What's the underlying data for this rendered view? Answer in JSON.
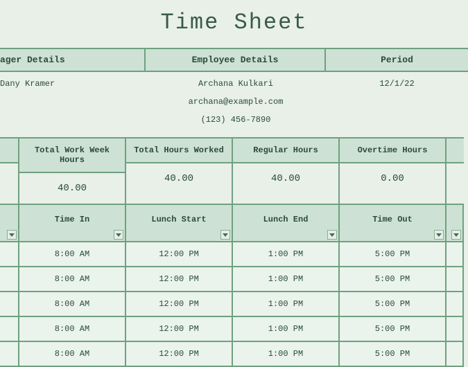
{
  "title": "Time Sheet",
  "headers": {
    "manager": "ager Details",
    "employee": "Employee Details",
    "period": "Period"
  },
  "manager": {
    "name": "Dany Kramer"
  },
  "employee": {
    "name": "Archana Kulkari",
    "email": "archana@example.com",
    "phone": "(123) 456-7890"
  },
  "period": "12/1/22",
  "summary": {
    "headers": {
      "work_week": "Total Work Week Hours",
      "worked": "Total Hours Worked",
      "regular": "Regular Hours",
      "overtime": "Overtime Hours"
    },
    "values": {
      "work_week": "40.00",
      "worked": "40.00",
      "regular": "40.00",
      "overtime": "0.00"
    }
  },
  "time_headers": {
    "time_in": "Time In",
    "lunch_start": "Lunch Start",
    "lunch_end": "Lunch End",
    "time_out": "Time Out"
  },
  "rows": [
    {
      "time_in": "8:00 AM",
      "lunch_start": "12:00 PM",
      "lunch_end": "1:00 PM",
      "time_out": "5:00 PM"
    },
    {
      "time_in": "8:00 AM",
      "lunch_start": "12:00 PM",
      "lunch_end": "1:00 PM",
      "time_out": "5:00 PM"
    },
    {
      "time_in": "8:00 AM",
      "lunch_start": "12:00 PM",
      "lunch_end": "1:00 PM",
      "time_out": "5:00 PM"
    },
    {
      "time_in": "8:00 AM",
      "lunch_start": "12:00 PM",
      "lunch_end": "1:00 PM",
      "time_out": "5:00 PM"
    },
    {
      "time_in": "8:00 AM",
      "lunch_start": "12:00 PM",
      "lunch_end": "1:00 PM",
      "time_out": "5:00 PM"
    }
  ]
}
